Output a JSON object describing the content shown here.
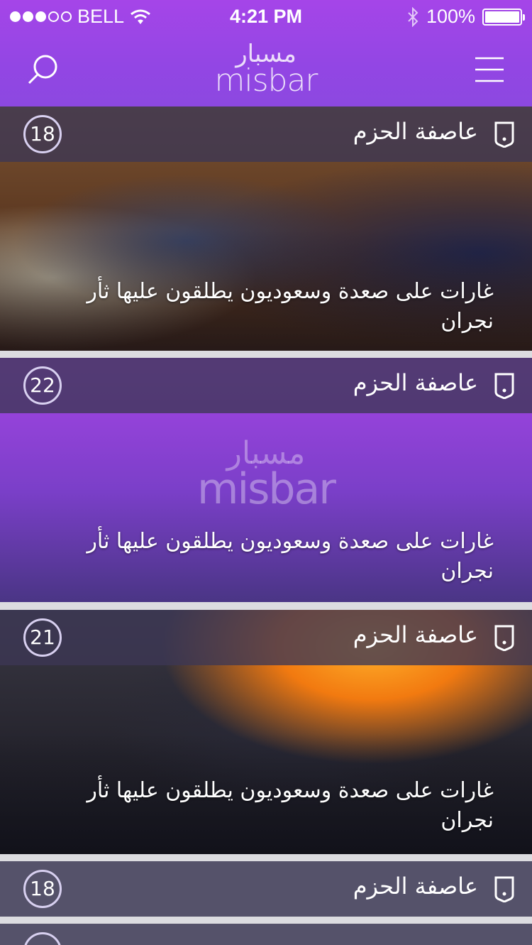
{
  "status_bar": {
    "carrier": "BELL",
    "time": "4:21 PM",
    "battery": "100%"
  },
  "header": {
    "logo_ar": "مسبار",
    "logo_en": "misbar"
  },
  "feed": [
    {
      "category": "عاصفة الحزم",
      "count": "18",
      "headline": "غارات على صعدة وسعوديون يطلقون عليها ثأر نجران",
      "image": "photo-meeting"
    },
    {
      "category": "عاصفة الحزم",
      "count": "22",
      "headline": "غارات على صعدة وسعوديون يطلقون عليها ثأر نجران",
      "image": "placeholder-logo",
      "watermark_ar": "مسبار",
      "watermark_en": "misbar"
    },
    {
      "category": "عاصفة الحزم",
      "count": "21",
      "headline": "غارات على صعدة وسعوديون يطلقون عليها ثأر نجران",
      "image": "photo-armored-vehicle"
    },
    {
      "category": "عاصفة الحزم",
      "count": "18"
    }
  ],
  "colors": {
    "header_top": "#a545e8",
    "header_bottom": "#8c48e0",
    "category_bar": "#3c3755"
  },
  "icons": {
    "search": "search-icon",
    "menu": "hamburger-menu-icon",
    "bookmark": "bookmark-icon"
  }
}
